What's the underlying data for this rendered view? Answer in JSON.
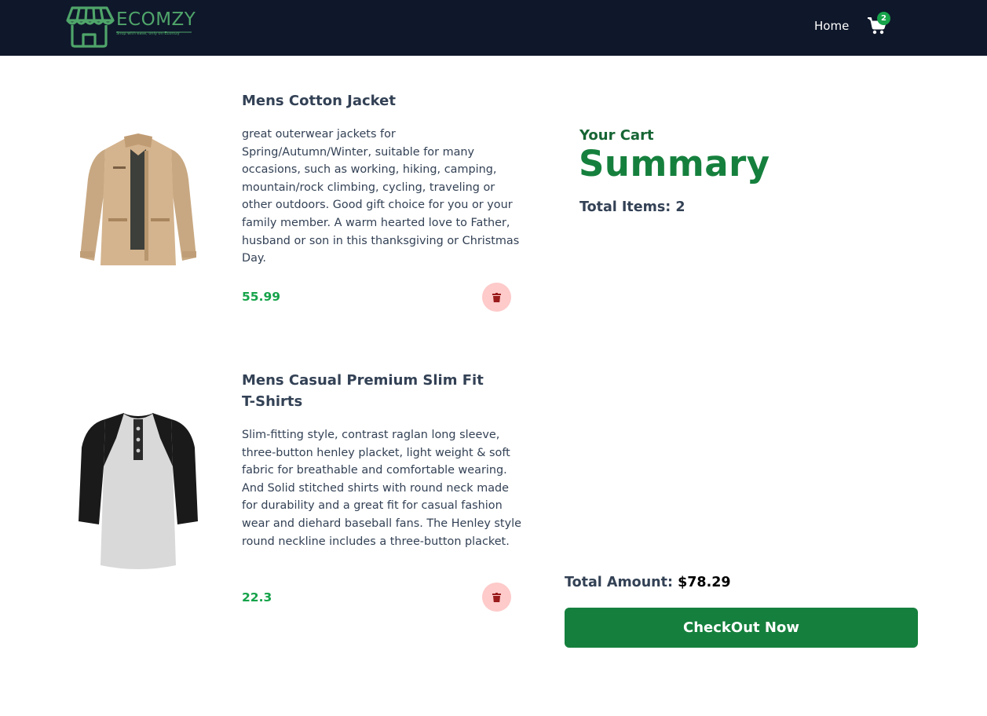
{
  "navbar": {
    "logo": {
      "text": "ECOMZY",
      "tagline": "Shop with ease, only on Ecomzy",
      "icon": "storefront-icon"
    },
    "home_label": "Home",
    "cart_icon": "shopping-cart-icon",
    "cart_count": "2",
    "colors": {
      "background": "#0f172a",
      "logo": "#4fa56a",
      "badge": "#16a34a"
    }
  },
  "cart": {
    "items": [
      {
        "title": "Mens Cotton Jacket",
        "description": "great outerwear jackets for Spring/Autumn/Winter, suitable for many occasions, such as working, hiking, camping, mountain/rock climbing, cycling, traveling or other outdoors. Good gift choice for you or your family member. A warm hearted love to Father, husband or son in this thanksgiving or Christmas Day.",
        "price": "55.99",
        "image": "jacket-image",
        "delete_icon": "trash-icon"
      },
      {
        "title": "Mens Casual Premium Slim Fit T-Shirts",
        "description": "Slim-fitting style, contrast raglan long sleeve, three-button henley placket, light weight & soft fabric for breathable and comfortable wearing. And Solid stitched shirts with round neck made for durability and a great fit for casual fashion wear and diehard baseball fans. The Henley style round neckline includes a three-button placket.",
        "price": "22.3",
        "image": "tshirt-image",
        "delete_icon": "trash-icon"
      }
    ]
  },
  "summary": {
    "subtitle": "Your Cart",
    "title": "Summary",
    "total_items_label": "Total Items: 2",
    "total_amount_label": "Total Amount:",
    "total_amount_value": "$78.29",
    "checkout_label": "CheckOut Now",
    "colors": {
      "accent": "#15803d",
      "price": "#16a34a",
      "delete_bg": "#fecaca",
      "delete_icon": "#991b1b"
    }
  }
}
